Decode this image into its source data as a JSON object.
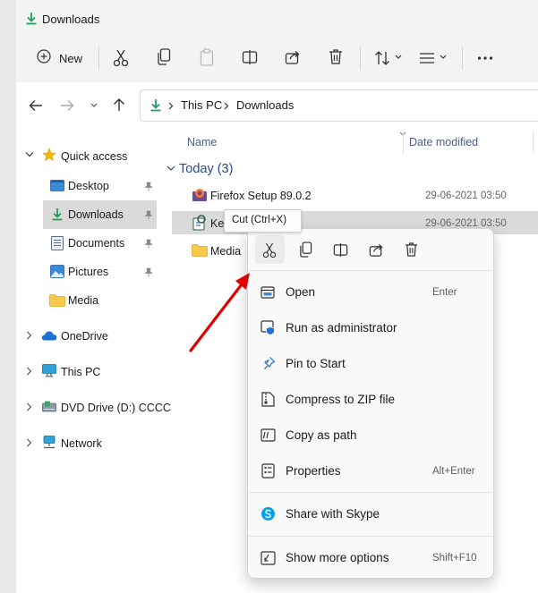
{
  "window": {
    "title": "Downloads"
  },
  "toolbar": {
    "new_label": "New"
  },
  "address": {
    "segments": [
      "This PC",
      "Downloads"
    ]
  },
  "sidebar": {
    "items": [
      {
        "label": "Quick access"
      },
      {
        "label": "Desktop"
      },
      {
        "label": "Downloads"
      },
      {
        "label": "Documents"
      },
      {
        "label": "Pictures"
      },
      {
        "label": "Media"
      },
      {
        "label": "OneDrive"
      },
      {
        "label": "This PC"
      },
      {
        "label": "DVD Drive (D:) CCCC"
      },
      {
        "label": "Network"
      }
    ]
  },
  "file_list": {
    "columns": [
      "Name",
      "Date modified"
    ],
    "group_label": "Today (3)",
    "rows": [
      {
        "name": "Firefox Setup 89.0.2",
        "date": "29-06-2021 03:50",
        "icon": "firefox-installer-icon"
      },
      {
        "name": "KeePas",
        "date": "29-06-2021 03:50",
        "icon": "keepass-installer-icon"
      },
      {
        "name": "Media",
        "date": "",
        "icon": "folder-icon"
      }
    ]
  },
  "tooltip": {
    "text": "Cut (Ctrl+X)"
  },
  "context_menu": {
    "items": [
      {
        "label": "Open",
        "shortcut": "Enter"
      },
      {
        "label": "Run as administrator",
        "shortcut": ""
      },
      {
        "label": "Pin to Start",
        "shortcut": ""
      },
      {
        "label": "Compress to ZIP file",
        "shortcut": ""
      },
      {
        "label": "Copy as path",
        "shortcut": ""
      },
      {
        "label": "Properties",
        "shortcut": "Alt+Enter"
      },
      {
        "label": "Share with Skype",
        "shortcut": ""
      },
      {
        "label": "Show more options",
        "shortcut": "Shift+F10"
      }
    ]
  },
  "colors": {
    "accent": "#0067c0",
    "download_green": "#20a060",
    "arrow_red": "#e00000"
  }
}
